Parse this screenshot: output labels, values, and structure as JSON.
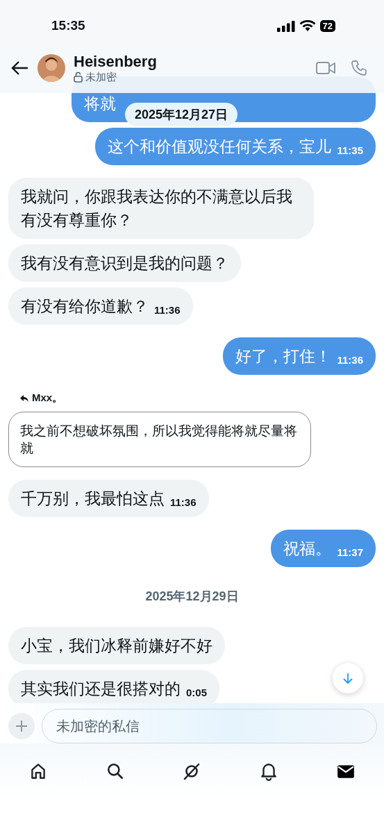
{
  "status_bar": {
    "time": "15:35",
    "battery": "72"
  },
  "header": {
    "name": "Heisenberg",
    "subtitle": "未加密"
  },
  "sticky_date": "2025年12月27日",
  "messages": [
    {
      "kind": "sent",
      "text": "将就"
    },
    {
      "kind": "sent",
      "text": "这个和价值观没任何关系，宝儿",
      "time": "11:35"
    },
    {
      "kind": "received",
      "text": "我就问，你跟我表达你的不满意以后我有没有尊重你？"
    },
    {
      "kind": "received",
      "text": "我有没有意识到是我的问题？"
    },
    {
      "kind": "received",
      "text": "有没有给你道歉？",
      "time": "11:36"
    },
    {
      "kind": "sent",
      "text": "好了，打住！",
      "time": "11:36"
    },
    {
      "kind": "reply_quote",
      "author": "Mxx。",
      "text": "我之前不想破坏氛围，所以我觉得能将就尽量将就"
    },
    {
      "kind": "received",
      "text": "千万别，我最怕这点",
      "time": "11:36"
    },
    {
      "kind": "sent",
      "text": "祝福。",
      "time": "11:37"
    },
    {
      "kind": "date",
      "text": "2025年12月29日"
    },
    {
      "kind": "received",
      "text": "小宝，我们冰释前嫌好不好"
    },
    {
      "kind": "received",
      "text": "其实我们还是很搭对的",
      "time": "0:05"
    }
  ],
  "composer": {
    "placeholder": "未加密的私信"
  },
  "tab_bar": [
    {
      "kind": "home",
      "selected": false
    },
    {
      "kind": "search",
      "selected": false
    },
    {
      "kind": "grok",
      "selected": false
    },
    {
      "kind": "bell",
      "selected": false
    },
    {
      "kind": "mail",
      "selected": true
    }
  ]
}
